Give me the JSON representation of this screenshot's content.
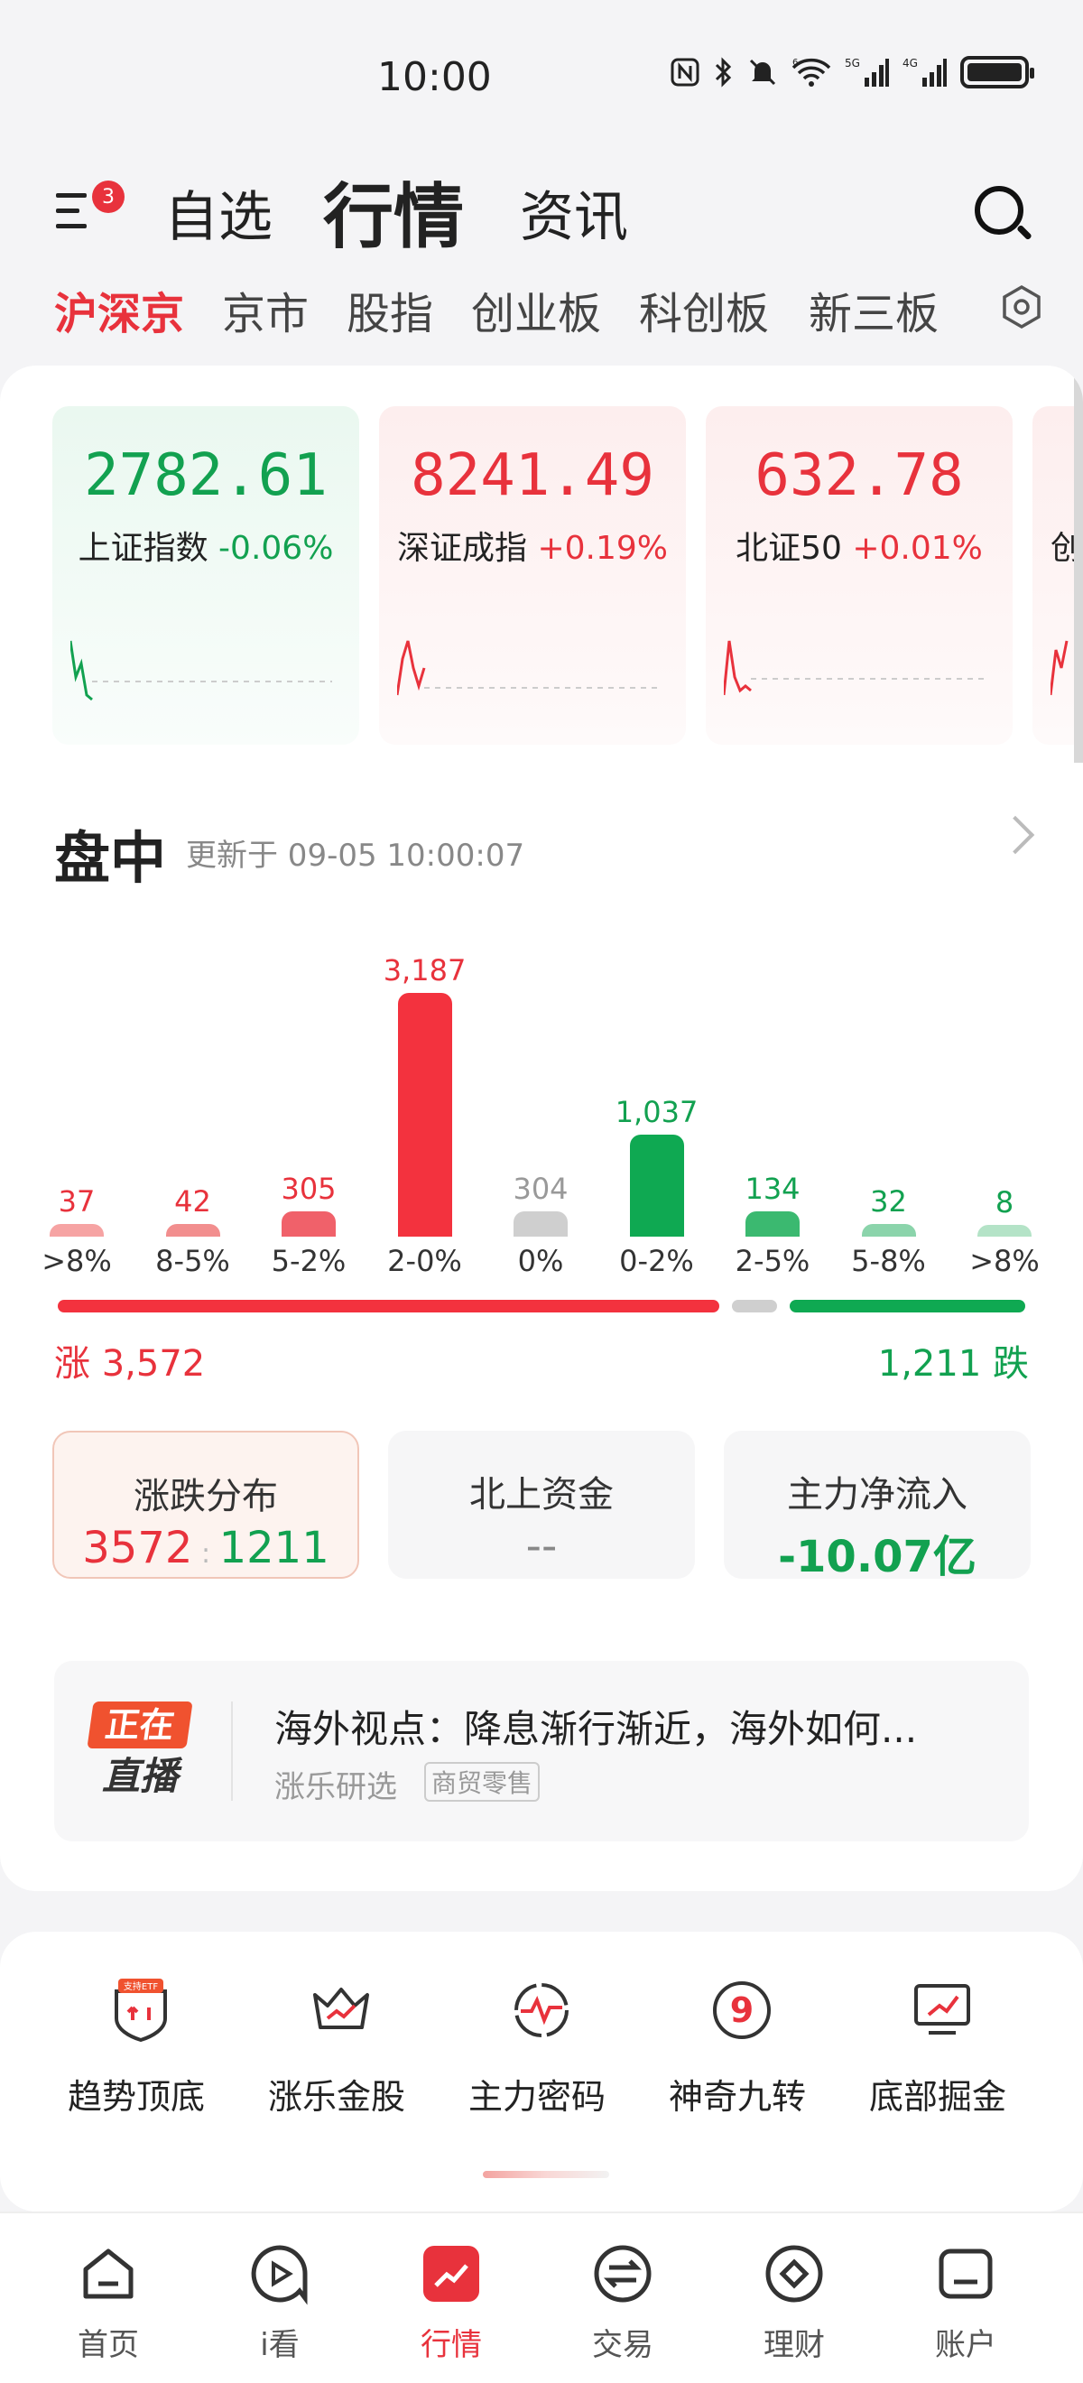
{
  "status_bar": {
    "time": "10:00",
    "signal_labels": [
      "6",
      "5G",
      "4G"
    ]
  },
  "header": {
    "menu_badge": "3",
    "tabs": [
      {
        "label": "自选",
        "active": false
      },
      {
        "label": "行情",
        "active": true
      },
      {
        "label": "资讯",
        "active": false
      }
    ]
  },
  "sub_tabs": [
    {
      "label": "沪深京",
      "active": true
    },
    {
      "label": "京市",
      "active": false
    },
    {
      "label": "股指",
      "active": false
    },
    {
      "label": "创业板",
      "active": false
    },
    {
      "label": "科创板",
      "active": false
    },
    {
      "label": "新三板",
      "active": false
    }
  ],
  "indices": [
    {
      "value": "2782.61",
      "name": "上证指数",
      "change": "-0.06%",
      "direction": "down"
    },
    {
      "value": "8241.49",
      "name": "深证成指",
      "change": "+0.19%",
      "direction": "up"
    },
    {
      "value": "632.78",
      "name": "北证50",
      "change": "+0.01%",
      "direction": "up"
    },
    {
      "value": "",
      "name": "创",
      "change": "",
      "direction": "up"
    }
  ],
  "intraday": {
    "title": "盘中",
    "updated": "更新于 09-05 10:00:07"
  },
  "chart_data": {
    "type": "bar",
    "categories": [
      ">8%",
      "8-5%",
      "5-2%",
      "2-0%",
      "0%",
      "0-2%",
      "2-5%",
      "5-8%",
      ">8%"
    ],
    "values": [
      37,
      42,
      305,
      3187,
      304,
      1037,
      134,
      32,
      8
    ],
    "value_labels": [
      "37",
      "42",
      "305",
      "3,187",
      "304",
      "1,037",
      "134",
      "32",
      "8"
    ],
    "colors": [
      "#f6a3a3",
      "#f28e8e",
      "#f0616a",
      "#f3323e",
      "#cfcfcf",
      "#0fa952",
      "#3bb970",
      "#8bd4ab",
      "#b4e3c7"
    ],
    "label_colors": [
      "#e8323c",
      "#e8323c",
      "#e8323c",
      "#e8323c",
      "#999999",
      "#12a150",
      "#12a150",
      "#12a150",
      "#12a150"
    ],
    "ylim": [
      0,
      3187
    ]
  },
  "totals": {
    "up_label": "涨 3,572",
    "down_label": "1,211 跌",
    "up": 3572,
    "flat": 304,
    "down": 1211
  },
  "stats": [
    {
      "title": "涨跌分布",
      "value_up": "3572",
      "value_down": "1211",
      "active": true
    },
    {
      "title": "北上资金",
      "value": "--",
      "active": false
    },
    {
      "title": "主力净流入",
      "value": "-10.07亿",
      "active": false
    }
  ],
  "live": {
    "badge_top": "正在",
    "badge_bottom": "直播",
    "title": "海外视点：降息渐行渐近，海外如何...",
    "author": "涨乐研选",
    "tag": "商贸零售"
  },
  "tools": [
    {
      "label": "趋势顶底",
      "icon": "shield-etf-icon",
      "icon_badge": "支持ETF"
    },
    {
      "label": "涨乐金股",
      "icon": "crown-chart-icon"
    },
    {
      "label": "主力密码",
      "icon": "pulse-target-icon"
    },
    {
      "label": "神奇九转",
      "icon": "nine-circle-icon",
      "icon_text": "9"
    },
    {
      "label": "底部掘金",
      "icon": "monitor-trend-icon"
    }
  ],
  "bottom_nav": [
    {
      "label": "首页",
      "icon": "home-icon",
      "active": false
    },
    {
      "label": "i看",
      "icon": "play-icon",
      "active": false
    },
    {
      "label": "行情",
      "icon": "market-icon",
      "active": true
    },
    {
      "label": "交易",
      "icon": "exchange-icon",
      "active": false
    },
    {
      "label": "理财",
      "icon": "diamond-icon",
      "active": false
    },
    {
      "label": "账户",
      "icon": "account-icon",
      "active": false
    }
  ]
}
